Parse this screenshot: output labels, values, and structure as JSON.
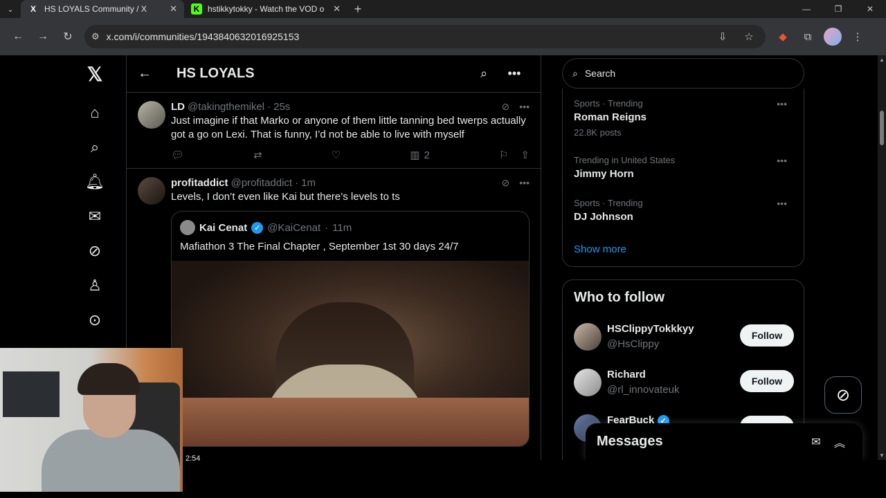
{
  "browser": {
    "tabs": [
      {
        "title": "HS LOYALS Community / X",
        "favicon": "X",
        "active": true
      },
      {
        "title": "hstikkytokky - Watch the VOD o",
        "favicon": "K",
        "active": false
      }
    ],
    "url": "x.com/i/communities/1943840632016925153"
  },
  "header": {
    "title": "HS LOYALS"
  },
  "posts": [
    {
      "name": "LD",
      "handle": "@takingthemikel",
      "time": "25s",
      "text": "Just imagine if that Marko or anyone of them little tanning bed twerps actually got a go on Lexi. That is funny, I’d not be able to live with myself",
      "views": "2"
    },
    {
      "name": "profitaddict",
      "handle": "@profitaddict",
      "time": "1m",
      "text": "Levels, I don’t even like Kai but there’s levels to ts",
      "quote": {
        "name": "Kai Cenat",
        "handle": "@KaiCenat",
        "time": "11m",
        "text": "Mafiathon 3 The Final Chapter , September 1st 30 days 24/7"
      }
    }
  ],
  "search": {
    "placeholder": "Search"
  },
  "trends": [
    {
      "context": "Sports · Trending",
      "name": "Roman Reigns",
      "count": "22.8K posts"
    },
    {
      "context": "Trending in United States",
      "name": "Jimmy Horn",
      "count": ""
    },
    {
      "context": "Sports · Trending",
      "name": "DJ Johnson",
      "count": ""
    }
  ],
  "show_more": "Show more",
  "who_to_follow": {
    "title": "Who to follow",
    "users": [
      {
        "name": "HSClippyTokkkyy",
        "handle": "@HsClippy",
        "button": "Follow"
      },
      {
        "name": "Richard",
        "handle": "@rl_innovateuk",
        "button": "Follow"
      },
      {
        "name": "FearBuck",
        "handle": "",
        "button": ""
      }
    ]
  },
  "messages": {
    "title": "Messages"
  },
  "video_timer": "2:54",
  "colors": {
    "accent": "#1d9bf0",
    "background": "#000000",
    "border": "#2f3336",
    "muted": "#71767b"
  },
  "icons": {
    "home": "home-icon",
    "explore": "search-icon",
    "notifications": "bell-icon",
    "messages": "mail-icon",
    "grok": "grok-icon",
    "profile": "person-icon",
    "more": "more-circle-icon"
  }
}
